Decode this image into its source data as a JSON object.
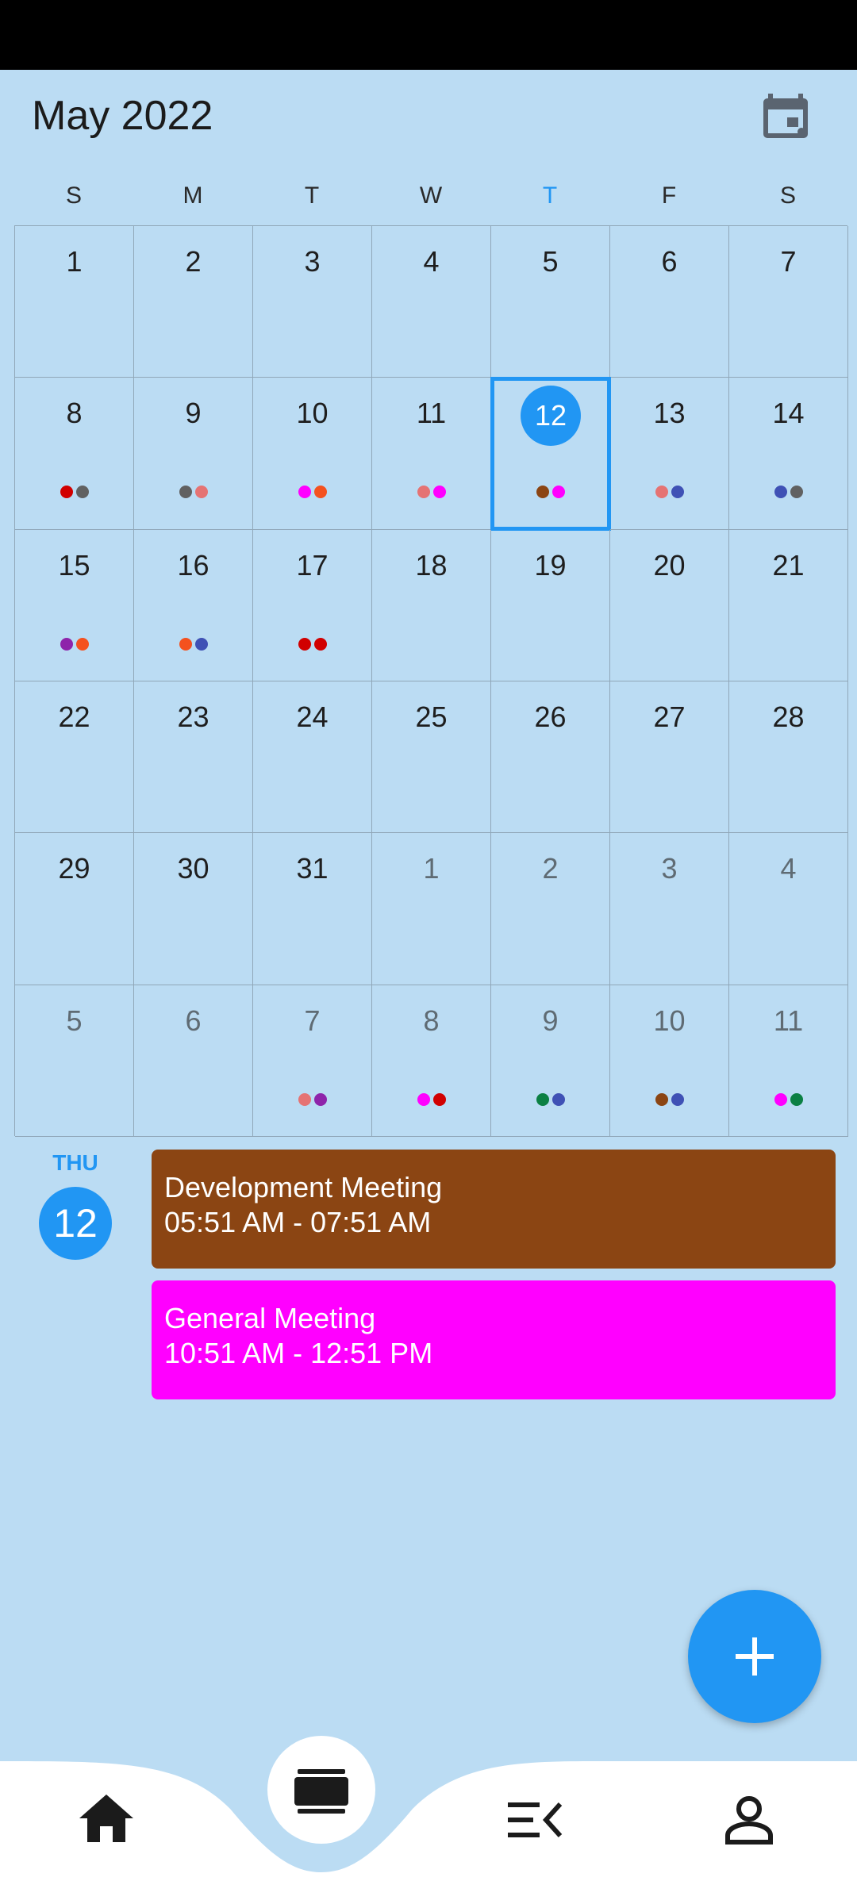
{
  "header": {
    "month_title": "May 2022",
    "calendar_icon": "calendar-today-icon"
  },
  "weekdays": [
    {
      "label": "S",
      "today": false
    },
    {
      "label": "M",
      "today": false
    },
    {
      "label": "T",
      "today": false
    },
    {
      "label": "W",
      "today": false
    },
    {
      "label": "T",
      "today": true
    },
    {
      "label": "F",
      "today": false
    },
    {
      "label": "S",
      "today": false
    }
  ],
  "days": [
    {
      "num": "1",
      "outside": false,
      "dots": []
    },
    {
      "num": "2",
      "outside": false,
      "dots": []
    },
    {
      "num": "3",
      "outside": false,
      "dots": []
    },
    {
      "num": "4",
      "outside": false,
      "dots": []
    },
    {
      "num": "5",
      "outside": false,
      "dots": []
    },
    {
      "num": "6",
      "outside": false,
      "dots": []
    },
    {
      "num": "7",
      "outside": false,
      "dots": []
    },
    {
      "num": "8",
      "outside": false,
      "dots": [
        "#d10000",
        "#616161"
      ]
    },
    {
      "num": "9",
      "outside": false,
      "dots": [
        "#616161",
        "#e57373"
      ]
    },
    {
      "num": "10",
      "outside": false,
      "dots": [
        "#ff00ff",
        "#f4511e"
      ]
    },
    {
      "num": "11",
      "outside": false,
      "dots": [
        "#e57373",
        "#ff00ff"
      ]
    },
    {
      "num": "12",
      "outside": false,
      "selected": true,
      "dots": [
        "#8b4513",
        "#ff00ff"
      ]
    },
    {
      "num": "13",
      "outside": false,
      "dots": [
        "#e57373",
        "#3f51b5"
      ]
    },
    {
      "num": "14",
      "outside": false,
      "dots": [
        "#3f51b5",
        "#616161"
      ]
    },
    {
      "num": "15",
      "outside": false,
      "dots": [
        "#8e24aa",
        "#f4511e"
      ]
    },
    {
      "num": "16",
      "outside": false,
      "dots": [
        "#f4511e",
        "#3f51b5"
      ]
    },
    {
      "num": "17",
      "outside": false,
      "dots": [
        "#d10000",
        "#d10000"
      ]
    },
    {
      "num": "18",
      "outside": false,
      "dots": []
    },
    {
      "num": "19",
      "outside": false,
      "dots": []
    },
    {
      "num": "20",
      "outside": false,
      "dots": []
    },
    {
      "num": "21",
      "outside": false,
      "dots": []
    },
    {
      "num": "22",
      "outside": false,
      "dots": []
    },
    {
      "num": "23",
      "outside": false,
      "dots": []
    },
    {
      "num": "24",
      "outside": false,
      "dots": []
    },
    {
      "num": "25",
      "outside": false,
      "dots": []
    },
    {
      "num": "26",
      "outside": false,
      "dots": []
    },
    {
      "num": "27",
      "outside": false,
      "dots": []
    },
    {
      "num": "28",
      "outside": false,
      "dots": []
    },
    {
      "num": "29",
      "outside": false,
      "dots": []
    },
    {
      "num": "30",
      "outside": false,
      "dots": []
    },
    {
      "num": "31",
      "outside": false,
      "dots": []
    },
    {
      "num": "1",
      "outside": true,
      "dots": []
    },
    {
      "num": "2",
      "outside": true,
      "dots": []
    },
    {
      "num": "3",
      "outside": true,
      "dots": []
    },
    {
      "num": "4",
      "outside": true,
      "dots": []
    },
    {
      "num": "5",
      "outside": true,
      "dots": []
    },
    {
      "num": "6",
      "outside": true,
      "dots": []
    },
    {
      "num": "7",
      "outside": true,
      "dots": [
        "#e57373",
        "#8e24aa"
      ]
    },
    {
      "num": "8",
      "outside": true,
      "dots": [
        "#ff00ff",
        "#d10000"
      ]
    },
    {
      "num": "9",
      "outside": true,
      "dots": [
        "#0b8043",
        "#3f51b5"
      ]
    },
    {
      "num": "10",
      "outside": true,
      "dots": [
        "#8b4513",
        "#3f51b5"
      ]
    },
    {
      "num": "11",
      "outside": true,
      "dots": [
        "#ff00ff",
        "#0b8043"
      ]
    }
  ],
  "selected_day": {
    "abbr": "THU",
    "num": "12"
  },
  "events": [
    {
      "title": "Development Meeting",
      "time": "05:51 AM - 07:51 AM",
      "color": "#8b4513"
    },
    {
      "title": "General Meeting",
      "time": "10:51 AM - 12:51 PM",
      "color": "#ff00ff"
    }
  ],
  "fab": {
    "icon": "plus-icon"
  },
  "nav": [
    {
      "icon": "home-icon"
    },
    {
      "icon": "calendar-view-icon"
    },
    {
      "icon": "menu-open-icon"
    },
    {
      "icon": "person-icon"
    }
  ],
  "colors": {
    "accent": "#2196f3",
    "background": "#bbdcf3"
  }
}
